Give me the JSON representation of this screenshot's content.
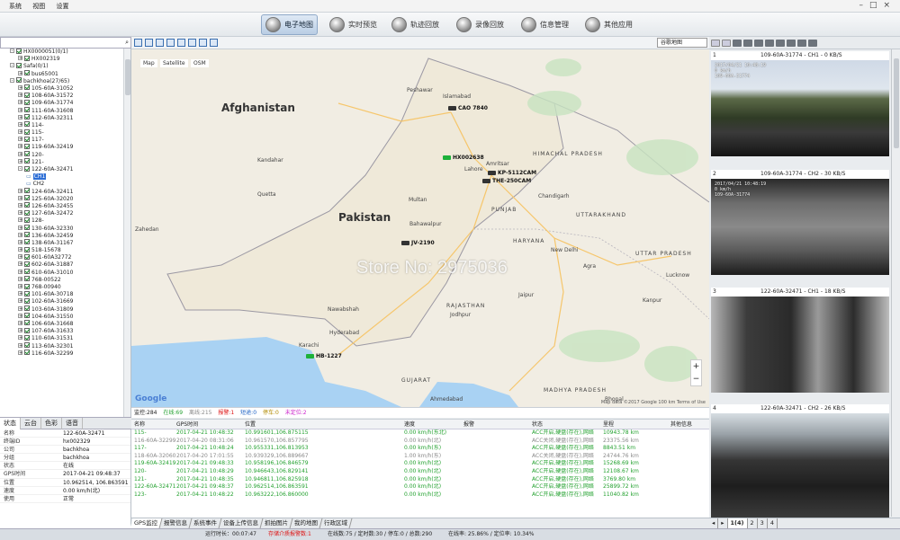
{
  "menu": {
    "items": [
      "系统",
      "视图",
      "设置"
    ]
  },
  "nav": [
    {
      "label": "电子地图",
      "active": true
    },
    {
      "label": "实时预览",
      "active": false
    },
    {
      "label": "轨迹回放",
      "active": false
    },
    {
      "label": "录像回放",
      "active": false
    },
    {
      "label": "信息管理",
      "active": false
    },
    {
      "label": "其他应用",
      "active": false
    }
  ],
  "tree": {
    "nodes": [
      {
        "label": "HX0000051(0/1)",
        "level": 1,
        "expand": "-",
        "checked": true
      },
      {
        "label": "HX002319",
        "level": 2,
        "expand": "+",
        "checked": true
      },
      {
        "label": "Safa(0/1)",
        "level": 1,
        "expand": "-",
        "checked": true
      },
      {
        "label": "bus65001",
        "level": 2,
        "expand": "+",
        "checked": true
      },
      {
        "label": "bachkhoa(27/65)",
        "level": 1,
        "expand": "-",
        "checked": true
      },
      {
        "label": "105-60A-31052",
        "level": 2,
        "expand": "+",
        "checked": true
      },
      {
        "label": "108-60A-31572",
        "level": 2,
        "expand": "+",
        "checked": true
      },
      {
        "label": "109-60A-31774",
        "level": 2,
        "expand": "+",
        "checked": true
      },
      {
        "label": "111-60A-31608",
        "level": 2,
        "expand": "+",
        "checked": true
      },
      {
        "label": "112-60A-32311",
        "level": 2,
        "expand": "+",
        "checked": true
      },
      {
        "label": "114-",
        "level": 2,
        "expand": "+",
        "checked": true
      },
      {
        "label": "115-",
        "level": 2,
        "expand": "+",
        "checked": true
      },
      {
        "label": "117-",
        "level": 2,
        "expand": "+",
        "checked": true
      },
      {
        "label": "119-60A-32419",
        "level": 2,
        "expand": "+",
        "checked": true
      },
      {
        "label": "120-",
        "level": 2,
        "expand": "+",
        "checked": true
      },
      {
        "label": "121-",
        "level": 2,
        "expand": "+",
        "checked": true
      },
      {
        "label": "122-60A-32471",
        "level": 2,
        "expand": "-",
        "checked": true
      },
      {
        "label": "CH1",
        "level": 3,
        "expand": "",
        "checked": false,
        "selected": true
      },
      {
        "label": "CH2",
        "level": 3,
        "expand": "",
        "checked": false
      },
      {
        "label": "124-60A-32411",
        "level": 2,
        "expand": "+",
        "checked": true
      },
      {
        "label": "125-60A-32020",
        "level": 2,
        "expand": "+",
        "checked": true
      },
      {
        "label": "126-60A-32455",
        "level": 2,
        "expand": "+",
        "checked": true
      },
      {
        "label": "127-60A-32472",
        "level": 2,
        "expand": "+",
        "checked": true
      },
      {
        "label": "128-",
        "level": 2,
        "expand": "+",
        "checked": true
      },
      {
        "label": "130-60A-32330",
        "level": 2,
        "expand": "+",
        "checked": true
      },
      {
        "label": "136-60A-32459",
        "level": 2,
        "expand": "+",
        "checked": true
      },
      {
        "label": "138-60A-31167",
        "level": 2,
        "expand": "+",
        "checked": true
      },
      {
        "label": "518-15678",
        "level": 2,
        "expand": "+",
        "checked": true
      },
      {
        "label": "601-60A32772",
        "level": 2,
        "expand": "+",
        "checked": true
      },
      {
        "label": "602-60A-31887",
        "level": 2,
        "expand": "+",
        "checked": true
      },
      {
        "label": "610-60A-31010",
        "level": 2,
        "expand": "+",
        "checked": true
      },
      {
        "label": "768-00522",
        "level": 2,
        "expand": "+",
        "checked": true
      },
      {
        "label": "768-00940",
        "level": 2,
        "expand": "+",
        "checked": true
      },
      {
        "label": "101-60A-30718",
        "level": 2,
        "expand": "+",
        "checked": true
      },
      {
        "label": "102-60A-31669",
        "level": 2,
        "expand": "+",
        "checked": true
      },
      {
        "label": "103-60A-31809",
        "level": 2,
        "expand": "+",
        "checked": true
      },
      {
        "label": "104-60A-31550",
        "level": 2,
        "expand": "+",
        "checked": true
      },
      {
        "label": "106-60A-31668",
        "level": 2,
        "expand": "+",
        "checked": true
      },
      {
        "label": "107-60A-31633",
        "level": 2,
        "expand": "+",
        "checked": true
      },
      {
        "label": "110-60A-31531",
        "level": 2,
        "expand": "+",
        "checked": true
      },
      {
        "label": "113-60A-32301",
        "level": 2,
        "expand": "+",
        "checked": true
      },
      {
        "label": "116-60A-32299",
        "level": 2,
        "expand": "+",
        "checked": true
      }
    ]
  },
  "left_tabs": [
    "状态",
    "云台",
    "色彩",
    "语音"
  ],
  "props": [
    {
      "k": "名称",
      "v": "122-60A-32471"
    },
    {
      "k": "终端ID",
      "v": "hx002329"
    },
    {
      "k": "公司",
      "v": "bachkhoa"
    },
    {
      "k": "分组",
      "v": "bachkhoa"
    },
    {
      "k": "状态",
      "v": "在线"
    },
    {
      "k": "GPS时间",
      "v": "2017-04-21 09:48:37"
    },
    {
      "k": "位置",
      "v": "10.962514, 106.863591"
    },
    {
      "k": "速度",
      "v": "0.00 km/h(北)"
    },
    {
      "k": "使用",
      "v": "正常"
    }
  ],
  "map": {
    "type_tabs": [
      "Map",
      "Satellite",
      "OSM"
    ],
    "map_select": "谷歌地图",
    "countries": [
      "Afghanistan",
      "Pakistan"
    ],
    "cities": [
      "Peshawar",
      "Islamabad",
      "Kandahar",
      "Lahore",
      "Amritsar",
      "Multan",
      "Bahawalpur",
      "Zahedan",
      "Nawabshah",
      "Hyderabad",
      "Karachi",
      "Jodhpur",
      "Jaipur",
      "Agra",
      "New Delhi",
      "Lucknow",
      "Kanpur",
      "Ahmedabad",
      "Bhopal",
      "Chandigarh",
      "Quetta"
    ],
    "regions": [
      "HIMACHAL PRADESH",
      "PUNJAB",
      "UTTARAKHAND",
      "HARYANA",
      "RAJASTHAN",
      "UTTAR PRADESH",
      "MADHYA PRADESH",
      "GUJARAT"
    ],
    "vehicles": [
      {
        "label": "CAO 7840",
        "green": false
      },
      {
        "label": "HX002638",
        "green": true
      },
      {
        "label": "KP-5112CAM",
        "green": false
      },
      {
        "label": "THE-250CAM",
        "green": false
      },
      {
        "label": "JV-2190",
        "green": false
      },
      {
        "label": "HB-1227",
        "green": false
      }
    ],
    "google": "Google",
    "copyright": "Map data ©2017 Google  100 km  Terms of Use",
    "watermark": "Store No: 2975036"
  },
  "summary": {
    "monitor": "监控:284",
    "online": "在线:69",
    "offline": "离线:215",
    "alarm": "报警:1",
    "break": "短途:0",
    "park": "停车:0",
    "unlocated": "未定位:2"
  },
  "table": {
    "headers": [
      "名称",
      "GPS时间",
      "位置",
      "速度",
      "报警",
      "状态",
      "里程",
      "其他信息"
    ],
    "rows": [
      {
        "c": [
          "115-",
          "2017-04-21 10:48:32",
          "10.991601,106.875115",
          "0.00 km/h(东北)",
          "",
          "ACC开启,硬盘(存在),网络",
          "10943.78 km",
          ""
        ],
        "gray": false
      },
      {
        "c": [
          "116-60A-32299",
          "2017-04-20 08:31:06",
          "10.961570,106.857795",
          "0.00 km/h(北)",
          "",
          "ACC关闭,硬盘(存在),网络",
          "23375.56 km",
          ""
        ],
        "gray": true
      },
      {
        "c": [
          "117-",
          "2017-04-21 10:48:24",
          "10.955331,106.813953",
          "0.00 km/h(东)",
          "",
          "ACC开启,硬盘(存在),网络",
          "8843.51 km",
          ""
        ],
        "gray": false
      },
      {
        "c": [
          "118-60A-32060",
          "2017-04-20 17:01:55",
          "10.939329,106.889667",
          "1.00 km/h(东)",
          "",
          "ACC关闭,硬盘(存在),网络",
          "24744.76 km",
          ""
        ],
        "gray": true
      },
      {
        "c": [
          "119-60A-32419",
          "2017-04-21 09:48:33",
          "10.958196,106.846579",
          "0.00 km/h(北)",
          "",
          "ACC开启,硬盘(存在),网络",
          "15268.69 km",
          ""
        ],
        "gray": false
      },
      {
        "c": [
          "120-",
          "2017-04-21 10:48:29",
          "10.946643,106.829141",
          "0.00 km/h(北)",
          "",
          "ACC开启,硬盘(存在),网络",
          "12108.67 km",
          ""
        ],
        "gray": false
      },
      {
        "c": [
          "121-",
          "2017-04-21 10:48:35",
          "10.946811,106.825918",
          "0.00 km/h(北)",
          "",
          "ACC开启,硬盘(存在),网络",
          "3769.80 km",
          ""
        ],
        "gray": false
      },
      {
        "c": [
          "122-60A-32471",
          "2017-04-21 09:48:37",
          "10.962514,106.863591",
          "0.00 km/h(北)",
          "",
          "ACC开启,硬盘(存在),网络",
          "25899.72 km",
          ""
        ],
        "gray": false
      },
      {
        "c": [
          "123-",
          "2017-04-21 10:48:22",
          "10.963222,106.860000",
          "0.00 km/h(北)",
          "",
          "ACC开启,硬盘(存在),网络",
          "11040.82 km",
          ""
        ],
        "gray": false
      }
    ]
  },
  "bottom_tabs": [
    "GPS监控",
    "报警信息",
    "系统事件",
    "设备上传信息",
    "抓拍图片",
    "我的地图",
    "行政区域"
  ],
  "videos": [
    {
      "idx": "1",
      "title": "109-60A-31774 - CH1 - 0 KB/S",
      "osd1": "2017/04/21 10:48:19",
      "osd2": "0 km/h",
      "osd3": "109-60A-31774"
    },
    {
      "idx": "2",
      "title": "109-60A-31774 - CH2 - 30 KB/S",
      "osd1": "2017/04/21 10:48:19",
      "osd2": "0 km/h",
      "osd3": "109-60A-31774"
    },
    {
      "idx": "3",
      "title": "122-60A-32471 - CH1 - 18 KB/S",
      "osd1": "",
      "osd2": "",
      "osd3": ""
    },
    {
      "idx": "4",
      "title": "122-60A-32471 - CH2 - 26 KB/S",
      "osd1": "",
      "osd2": "",
      "osd3": ""
    }
  ],
  "video_pages": [
    "1(4)",
    "2",
    "3",
    "4"
  ],
  "status": {
    "runtime": "运行时长：00:07:47",
    "alarm": "存储介质报警数:1",
    "online": "在线数:75 / 定时数:30 / 停车:0 / 总数:290",
    "rate": "在线率: 25.86% / 定位率: 10.34%"
  },
  "colors": {
    "online": "#23a12f",
    "alarm": "#d11",
    "accent": "#2e6fd6"
  }
}
